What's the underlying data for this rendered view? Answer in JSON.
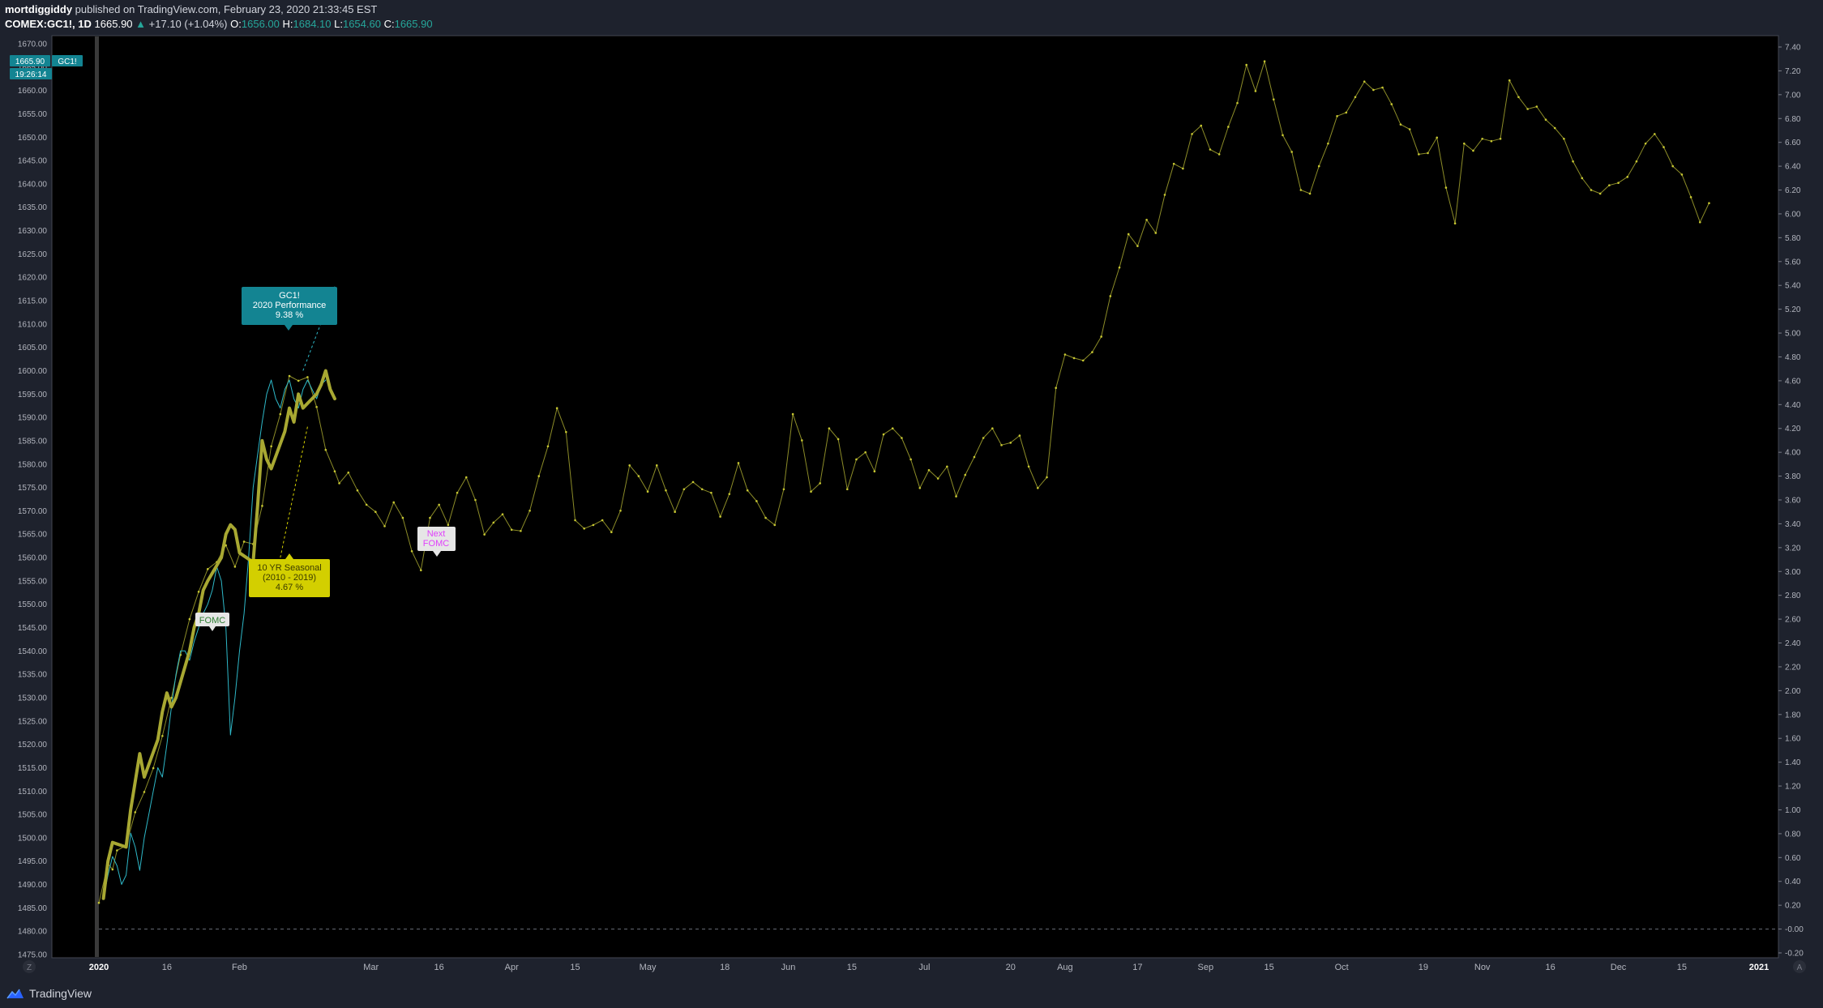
{
  "header": {
    "author": "mortdiggiddy",
    "published": "published on TradingView.com, February 23, 2020 21:33:45 EST",
    "symbol": "COMEX:GC1!, 1D",
    "last": "1665.90",
    "change": "+17.10 (+1.04%)",
    "o_label": "O:",
    "o_value": "1656.00",
    "h_label": "H:",
    "h_value": "1684.10",
    "l_label": "L:",
    "l_value": "1654.60",
    "c_label": "C:",
    "c_value": "1665.90"
  },
  "price_tag": {
    "price": "1665.90",
    "symbol": "GC1!",
    "countdown": "19:26:14"
  },
  "annotations": {
    "performance": [
      "GC1!",
      "2020 Performance",
      "9.38 %"
    ],
    "seasonal": [
      "10 YR Seasonal",
      "(2010 - 2019)",
      "4.67 %"
    ],
    "fomc": "FOMC",
    "next_fomc": [
      "Next",
      "FOMC"
    ]
  },
  "footer": {
    "brand": "TradingView",
    "left_scale_btn": "Z",
    "right_scale_btn": "A"
  },
  "colors": {
    "background": "#000000",
    "axis_panel": "#1e222d",
    "price": "#a8a832",
    "seasonal_thin": "#8c8c28",
    "seasonal_recent": "#2eb8c8",
    "perf_callout": "#138492",
    "seasonal_callout": "#d3cf00",
    "price_tag": "#138492"
  },
  "chart_data": {
    "type": "line",
    "x_axis": {
      "ticks": [
        "2020",
        "16",
        "Feb",
        "Mar",
        "16",
        "Apr",
        "15",
        "May",
        "18",
        "Jun",
        "15",
        "Jul",
        "20",
        "Aug",
        "17",
        "Sep",
        "15",
        "Oct",
        "19",
        "Nov",
        "16",
        "Dec",
        "15",
        "2021"
      ],
      "tick_days": [
        0,
        15,
        31,
        60,
        75,
        91,
        105,
        121,
        138,
        152,
        166,
        182,
        201,
        213,
        229,
        244,
        258,
        274,
        292,
        305,
        320,
        335,
        349,
        366
      ]
    },
    "left_axis": {
      "range": [
        1475,
        1670
      ],
      "ticks": [
        "1670.00",
        "1665.00",
        "1660.00",
        "1655.00",
        "1650.00",
        "1645.00",
        "1640.00",
        "1635.00",
        "1630.00",
        "1625.00",
        "1620.00",
        "1615.00",
        "1610.00",
        "1605.00",
        "1600.00",
        "1595.00",
        "1590.00",
        "1585.00",
        "1580.00",
        "1575.00",
        "1570.00",
        "1565.00",
        "1560.00",
        "1555.00",
        "1550.00",
        "1545.00",
        "1540.00",
        "1535.00",
        "1530.00",
        "1525.00",
        "1520.00",
        "1515.00",
        "1510.00",
        "1505.00",
        "1500.00",
        "1495.00",
        "1490.00",
        "1485.00",
        "1480.00",
        "1475.00"
      ]
    },
    "right_axis": {
      "range": [
        -0.2,
        7.4
      ],
      "ticks": [
        "7.40",
        "7.20",
        "7.00",
        "6.80",
        "6.60",
        "6.40",
        "6.20",
        "6.00",
        "5.80",
        "5.60",
        "5.40",
        "5.20",
        "5.00",
        "4.80",
        "4.60",
        "4.40",
        "4.20",
        "4.00",
        "3.80",
        "3.60",
        "3.40",
        "3.20",
        "3.00",
        "2.80",
        "2.60",
        "2.40",
        "2.20",
        "2.00",
        "1.80",
        "1.60",
        "1.40",
        "1.20",
        "1.00",
        "0.80",
        "0.60",
        "0.40",
        "0.20",
        "-0.00",
        "-0.20"
      ],
      "zero_line": 0
    },
    "series": [
      {
        "axis": "left",
        "style": "thick",
        "days": [
          1,
          2,
          3,
          6,
          7,
          8,
          9,
          10,
          13,
          14,
          15,
          16,
          17,
          20,
          21,
          22,
          23,
          24,
          27,
          28,
          29,
          30,
          31,
          34,
          35,
          36,
          37,
          38,
          41,
          42,
          43,
          44,
          45,
          48,
          49,
          50,
          51,
          52
        ],
        "values": [
          1487,
          1495,
          1499,
          1498,
          1506,
          1512,
          1518,
          1513,
          1521,
          1527,
          1531,
          1528,
          1530,
          1540,
          1545,
          1548,
          1553,
          1555,
          1560,
          1565,
          1567,
          1566,
          1561,
          1559,
          1571,
          1585,
          1581,
          1579,
          1587,
          1592,
          1589,
          1595,
          1592,
          1595,
          1597,
          1600,
          1596,
          1594
        ]
      },
      {
        "axis": "left",
        "style": "recent",
        "days": [
          1,
          2,
          3,
          4,
          5,
          6,
          7,
          8,
          9,
          10,
          11,
          12,
          13,
          14,
          15,
          16,
          17,
          18,
          19,
          20,
          21,
          22,
          23,
          24,
          25,
          26,
          27,
          28,
          29,
          30,
          31,
          32,
          33,
          34,
          35,
          36,
          37,
          38,
          39,
          40,
          41,
          42,
          43,
          44,
          45,
          46,
          47,
          48,
          49,
          50
        ],
        "values": [
          1487,
          1492,
          1496,
          1494,
          1490,
          1492,
          1501,
          1498,
          1493,
          1500,
          1505,
          1510,
          1515,
          1513,
          1520,
          1528,
          1535,
          1540,
          1540,
          1538,
          1542,
          1545,
          1548,
          1550,
          1553,
          1558,
          1555,
          1545,
          1522,
          1530,
          1540,
          1548,
          1560,
          1575,
          1582,
          1589,
          1595,
          1598,
          1594,
          1592,
          1596,
          1598,
          1594,
          1592,
          1596,
          1598,
          1596,
          1594,
          1597,
          1598
        ]
      },
      {
        "axis": "right",
        "style": "thin",
        "days": [
          0,
          2,
          3,
          4,
          6,
          8,
          10,
          12,
          14,
          16,
          18,
          20,
          22,
          24,
          26,
          28,
          30,
          32,
          34,
          36,
          38,
          40,
          42,
          44,
          46,
          48,
          50,
          52,
          53,
          55,
          57,
          59,
          61,
          63,
          65,
          67,
          69,
          71,
          73,
          75,
          77,
          79,
          81,
          83,
          85,
          87,
          89,
          91,
          93,
          95,
          97,
          99,
          101,
          103,
          105,
          107,
          109,
          111,
          113,
          115,
          117,
          119,
          121,
          123,
          125,
          127,
          129,
          131,
          133,
          135,
          137,
          139,
          141,
          143,
          145,
          147,
          149,
          151,
          153,
          155,
          157,
          159,
          161,
          163,
          165,
          167,
          169,
          171,
          173,
          175,
          177,
          179,
          181,
          183,
          185,
          187,
          189,
          191,
          193,
          195,
          197,
          199,
          201,
          203,
          205,
          207,
          209,
          211,
          213,
          215,
          217,
          219,
          221,
          223,
          225,
          227,
          229,
          231,
          233,
          235,
          237,
          239,
          241,
          243,
          245,
          247,
          249,
          251,
          253,
          255,
          257,
          259,
          261,
          263,
          265,
          267,
          269,
          271,
          273,
          275,
          277,
          279,
          281,
          283,
          285,
          287,
          289,
          291,
          293,
          295,
          297,
          299,
          301,
          303,
          305,
          307,
          309,
          311,
          313,
          315,
          317,
          319,
          321,
          323,
          325,
          327,
          329,
          331,
          333,
          335,
          337,
          339,
          341,
          343,
          345,
          347,
          349,
          351,
          353,
          355
        ],
        "values": [
          0.22,
          0.55,
          0.5,
          0.66,
          0.7,
          0.98,
          1.15,
          1.35,
          1.62,
          1.94,
          2.3,
          2.6,
          2.83,
          3.02,
          3.08,
          3.22,
          3.04,
          3.25,
          3.23,
          3.55,
          4.05,
          4.32,
          4.64,
          4.6,
          4.63,
          4.38,
          4.02,
          3.84,
          3.74,
          3.83,
          3.68,
          3.56,
          3.5,
          3.38,
          3.58,
          3.45,
          3.17,
          3.01,
          3.45,
          3.56,
          3.39,
          3.66,
          3.79,
          3.6,
          3.31,
          3.41,
          3.48,
          3.35,
          3.34,
          3.51,
          3.8,
          4.05,
          4.37,
          4.17,
          3.43,
          3.36,
          3.39,
          3.43,
          3.33,
          3.51,
          3.89,
          3.8,
          3.67,
          3.89,
          3.68,
          3.5,
          3.69,
          3.75,
          3.69,
          3.66,
          3.46,
          3.65,
          3.91,
          3.68,
          3.59,
          3.45,
          3.39,
          3.69,
          4.32,
          4.1,
          3.67,
          3.74,
          4.2,
          4.11,
          3.69,
          3.94,
          4.0,
          3.84,
          4.15,
          4.2,
          4.12,
          3.94,
          3.7,
          3.85,
          3.78,
          3.88,
          3.63,
          3.81,
          3.96,
          4.12,
          4.2,
          4.06,
          4.08,
          4.14,
          3.88,
          3.7,
          3.79,
          4.54,
          4.82,
          4.79,
          4.77,
          4.84,
          4.97,
          5.31,
          5.55,
          5.83,
          5.73,
          5.95,
          5.84,
          6.16,
          6.42,
          6.38,
          6.67,
          6.74,
          6.54,
          6.5,
          6.73,
          6.93,
          7.25,
          7.03,
          7.28,
          6.96,
          6.66,
          6.52,
          6.2,
          6.17,
          6.4,
          6.59,
          6.82,
          6.85,
          6.98,
          7.11,
          7.04,
          7.06,
          6.92,
          6.75,
          6.71,
          6.5,
          6.51,
          6.64,
          6.22,
          5.92,
          6.59,
          6.53,
          6.63,
          6.61,
          6.63,
          7.12,
          6.98,
          6.88,
          6.9,
          6.79,
          6.72,
          6.63,
          6.44,
          6.3,
          6.2,
          6.17,
          6.24,
          6.26,
          6.31,
          6.44,
          6.59,
          6.67,
          6.56,
          6.4,
          6.33,
          6.14,
          5.93,
          6.09,
          6.24,
          6.42,
          6.52,
          6.24,
          6.41,
          6.56,
          6.52,
          6.39,
          6.51,
          6.4,
          6.23,
          6.05,
          6.13,
          6.0,
          5.92,
          5.8,
          5.5,
          5.52,
          5.83,
          5.84,
          5.91,
          5.75,
          5.81,
          6.06,
          6.07,
          5.94,
          6.03,
          5.88,
          6.09,
          6.37,
          6.29,
          6.09,
          5.92,
          6.12,
          6.19,
          6.0,
          5.95,
          5.48,
          5.48,
          5.5,
          5.52,
          5.54,
          5.56,
          5.66,
          5.87,
          6.31,
          6.68,
          6.72,
          6.85
        ]
      }
    ],
    "connectors": [
      {
        "from_day": 45,
        "from_value": 1600,
        "to_day": 52,
        "to_value": 1618,
        "note": "performance"
      },
      {
        "from_day": 46,
        "from_value": 1588,
        "to_day": 40,
        "to_value": 1560,
        "note": "seasonal"
      }
    ]
  }
}
